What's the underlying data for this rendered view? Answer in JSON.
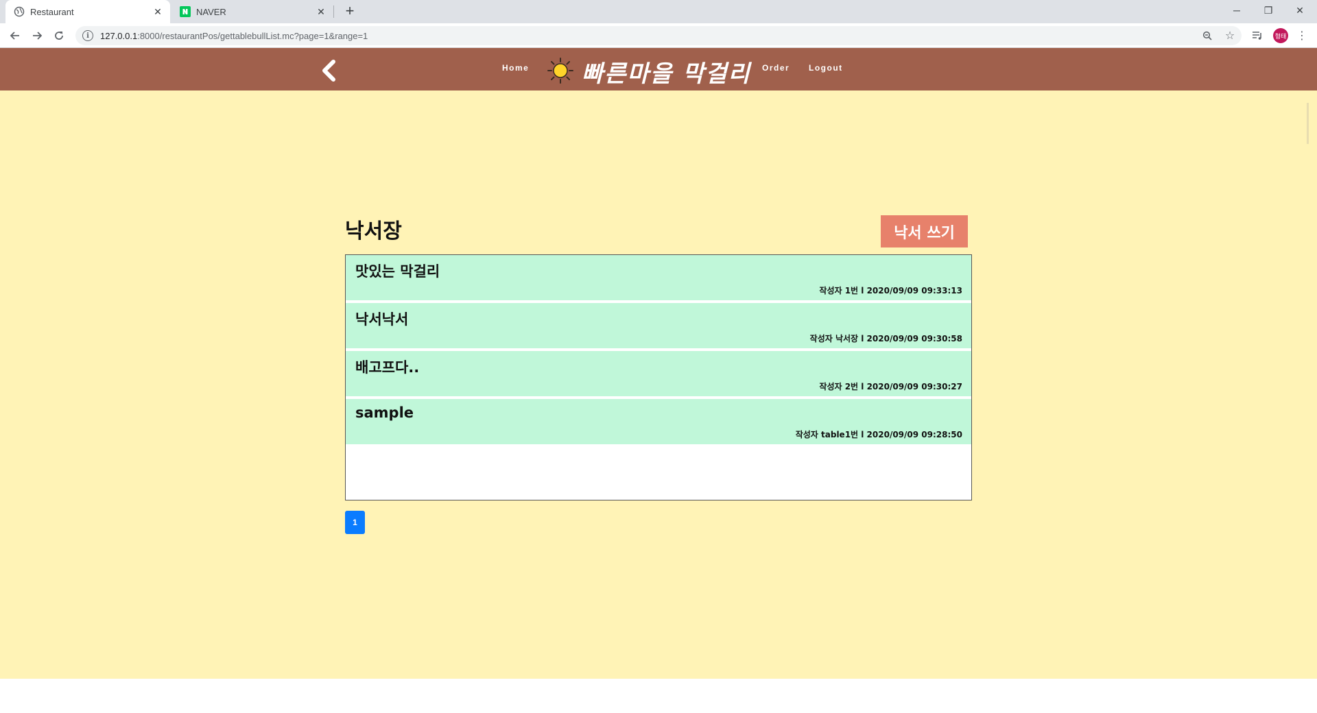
{
  "browser": {
    "tabs": [
      {
        "title": "Restaurant",
        "active": true
      },
      {
        "title": "NAVER",
        "active": false
      }
    ],
    "new_tab_label": "+",
    "url_host": "127.0.0.1",
    "url_path": ":8000/restaurantPos/gettablebullList.mc?page=1&range=1",
    "profile_label": "형태",
    "icons": [
      "globe-icon",
      "naver-icon",
      "close-icon",
      "new-tab-icon",
      "back-icon",
      "forward-icon",
      "reload-icon",
      "info-icon",
      "zoom-icon",
      "star-icon",
      "media-icon",
      "profile-avatar",
      "menu-icon",
      "minimize-icon",
      "restore-icon",
      "window-close-icon"
    ]
  },
  "header": {
    "nav_home": "Home",
    "logo_text": "빠른마을 막걸리",
    "nav_order": "Order",
    "nav_logout": "Logout"
  },
  "board": {
    "title": "낙서장",
    "write_button": "낙서 쓰기",
    "posts": [
      {
        "title": "맛있는 막걸리",
        "meta": "작성자 1번 l 2020/09/09 09:33:13"
      },
      {
        "title": "낙서낙서",
        "meta": "작성자 낙서장 l 2020/09/09 09:30:58"
      },
      {
        "title": "배고프다..",
        "meta": "작성자 2번 l 2020/09/09 09:30:27"
      },
      {
        "title": "sample",
        "meta": "작성자 table1번 l 2020/09/09 09:28:50"
      }
    ],
    "pagination": {
      "current_page": "1"
    }
  },
  "colors": {
    "header_bg": "#a0604c",
    "page_bg": "#fff3b6",
    "post_bg": "#c0f7d9",
    "write_button_bg": "#e7816b",
    "page_button_bg": "#0a7cff"
  }
}
